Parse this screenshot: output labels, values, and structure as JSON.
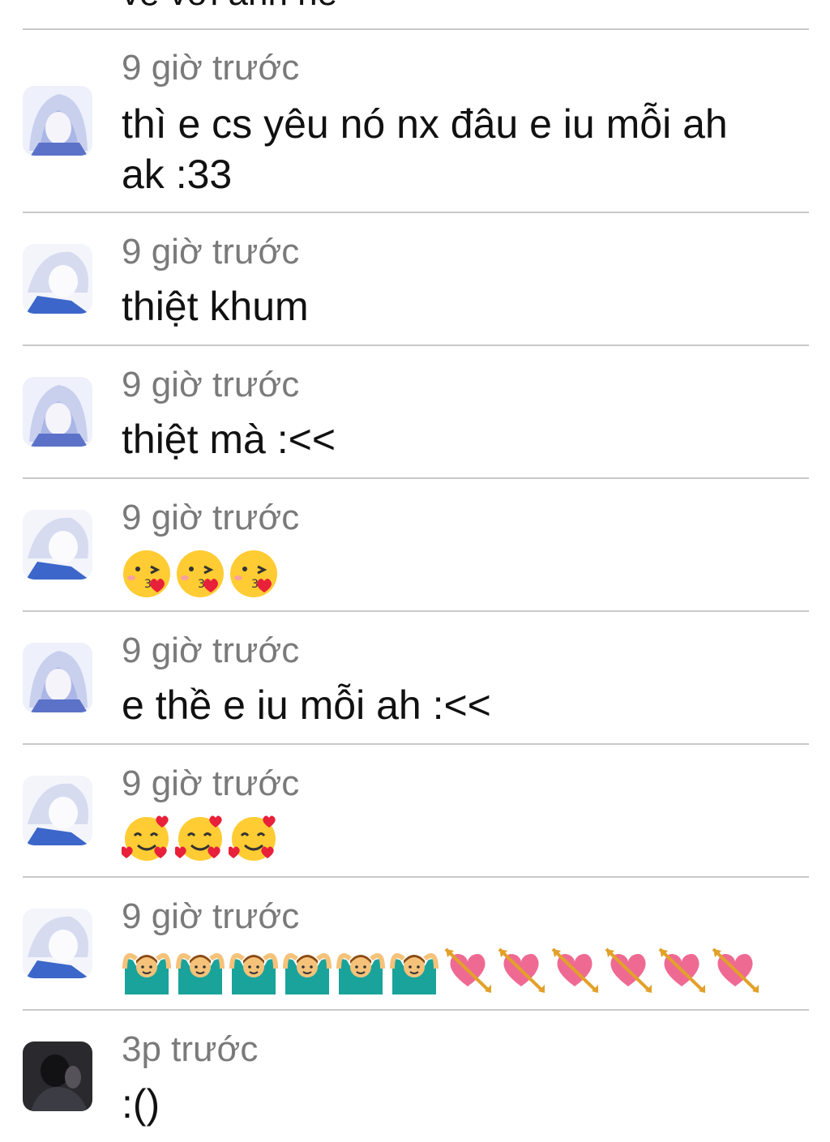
{
  "top_cutoff_text": "về với anh nè",
  "comments": [
    {
      "avatar": "anime-avatar-a",
      "time": "9 giờ trước",
      "text": "thì e cs yêu nó nx đâu e iu mỗi ah ak :33"
    },
    {
      "avatar": "anime-avatar-b",
      "time": "9 giờ trước",
      "text": "thiệt khum"
    },
    {
      "avatar": "anime-avatar-a",
      "time": "9 giờ trước",
      "text": "thiệt mà :<<"
    },
    {
      "avatar": "anime-avatar-b",
      "time": "9 giờ trước",
      "emoji": [
        "kissing-heart-emoji",
        "kissing-heart-emoji",
        "kissing-heart-emoji"
      ]
    },
    {
      "avatar": "anime-avatar-a",
      "time": "9 giờ trước",
      "text": "e thề e iu mỗi ah :<<"
    },
    {
      "avatar": "anime-avatar-b",
      "time": "9 giờ trước",
      "emoji": [
        "smiling-hearts-emoji",
        "smiling-hearts-emoji",
        "smiling-hearts-emoji"
      ]
    },
    {
      "avatar": "anime-avatar-b",
      "time": "9 giờ trước",
      "emoji": [
        "ok-gesture-man-emoji",
        "ok-gesture-man-emoji",
        "ok-gesture-man-emoji",
        "ok-gesture-man-emoji",
        "ok-gesture-man-emoji",
        "ok-gesture-man-emoji",
        "heart-arrow-emoji",
        "heart-arrow-emoji",
        "heart-arrow-emoji",
        "heart-arrow-emoji",
        "heart-arrow-emoji",
        "heart-arrow-emoji"
      ]
    },
    {
      "avatar": "dark-photo-avatar",
      "time": "3p trước",
      "text": ":()"
    }
  ]
}
